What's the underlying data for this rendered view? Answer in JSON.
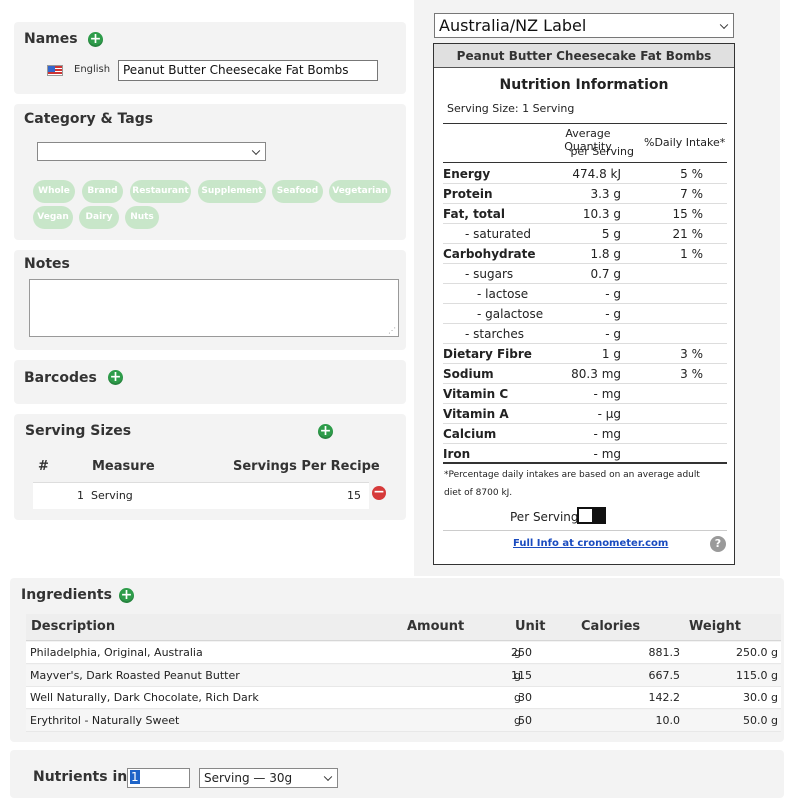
{
  "names": {
    "title": "Names",
    "language": "English",
    "value": "Peanut Butter Cheesecake Fat Bombs"
  },
  "category": {
    "title": "Category & Tags",
    "selected": "",
    "tags": [
      "Whole",
      "Brand",
      "Restaurant",
      "Supplement",
      "Seafood",
      "Vegetarian",
      "Vegan",
      "Dairy",
      "Nuts"
    ]
  },
  "notes": {
    "title": "Notes",
    "value": ""
  },
  "barcodes": {
    "title": "Barcodes"
  },
  "serving_sizes": {
    "title": "Serving Sizes",
    "headers": {
      "num": "#",
      "measure": "Measure",
      "servings": "Servings Per Recipe"
    },
    "rows": [
      {
        "num": "1",
        "measure": "Serving",
        "servings": "15"
      }
    ]
  },
  "label": {
    "selector": "Australia/NZ Label",
    "product": "Peanut Butter Cheesecake Fat Bombs",
    "heading": "Nutrition Information",
    "serving_size": "Serving Size: 1 Serving",
    "col_avg1": "Average Quantity",
    "col_avg2": "per Serving",
    "col_di": "%Daily Intake*",
    "rows": [
      {
        "name": "Energy",
        "qty": "474.8 kJ",
        "di": "5 %"
      },
      {
        "name": "Protein",
        "qty": "3.3 g",
        "di": "7 %"
      },
      {
        "name": "Fat, total",
        "qty": "10.3 g",
        "di": "15 %"
      },
      {
        "name": "- saturated",
        "qty": "5 g",
        "di": "21 %"
      },
      {
        "name": "Carbohydrate",
        "qty": "1.8 g",
        "di": "1 %"
      },
      {
        "name": "- sugars",
        "qty": "0.7 g",
        "di": ""
      },
      {
        "name": "- lactose",
        "qty": "- g",
        "di": ""
      },
      {
        "name": "- galactose",
        "qty": "- g",
        "di": ""
      },
      {
        "name": "- starches",
        "qty": "- g",
        "di": ""
      },
      {
        "name": "Dietary Fibre",
        "qty": "1 g",
        "di": "3 %"
      },
      {
        "name": "Sodium",
        "qty": "80.3 mg",
        "di": "3 %"
      },
      {
        "name": "Vitamin C",
        "qty": "- mg",
        "di": ""
      },
      {
        "name": "Vitamin A",
        "qty": "- µg",
        "di": ""
      },
      {
        "name": "Calcium",
        "qty": "- mg",
        "di": ""
      },
      {
        "name": "Iron",
        "qty": "- mg",
        "di": ""
      }
    ],
    "footnote1": "*Percentage daily intakes are based on an average adult",
    "footnote2": "diet of 8700 kJ.",
    "per_serving_label": "Per Serving",
    "full_info_link": "Full Info at cronometer.com",
    "help_icon": "?"
  },
  "ingredients": {
    "title": "Ingredients",
    "headers": {
      "description": "Description",
      "amount": "Amount",
      "unit": "Unit",
      "calories": "Calories",
      "weight": "Weight"
    },
    "rows": [
      {
        "description": "Philadelphia, Original, Australia",
        "amount": "250",
        "unit": "g",
        "calories": "881.3",
        "weight": "250.0 g"
      },
      {
        "description": "Mayver's, Dark Roasted Peanut Butter",
        "amount": "115",
        "unit": "g",
        "calories": "667.5",
        "weight": "115.0 g"
      },
      {
        "description": "Well Naturally, Dark Chocolate, Rich Dark",
        "amount": "30",
        "unit": "g",
        "calories": "142.2",
        "weight": "30.0 g"
      },
      {
        "description": "Erythritol - Naturally Sweet",
        "amount": "50",
        "unit": "g",
        "calories": "10.0",
        "weight": "50.0 g"
      }
    ]
  },
  "nutrients_in": {
    "label": "Nutrients in:",
    "quantity": "1",
    "unit": "Serving — 30g"
  }
}
